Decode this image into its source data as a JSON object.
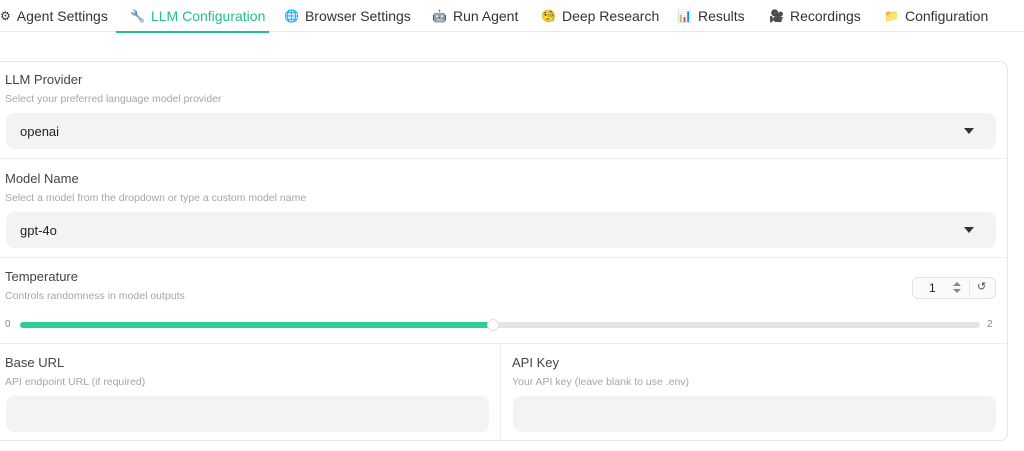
{
  "tabs": [
    {
      "icon": "⚙",
      "label": "Agent Settings"
    },
    {
      "icon": "🔧",
      "label": "LLM Configuration"
    },
    {
      "icon": "🌐",
      "label": "Browser Settings"
    },
    {
      "icon": "🤖",
      "label": "Run Agent"
    },
    {
      "icon": "🧐",
      "label": "Deep Research"
    },
    {
      "icon": "📊",
      "label": "Results"
    },
    {
      "icon": "🎥",
      "label": "Recordings"
    },
    {
      "icon": "📁",
      "label": "Configuration"
    }
  ],
  "active_tab": "LLM Configuration",
  "provider": {
    "label": "LLM Provider",
    "hint": "Select your preferred language model provider",
    "value": "openai"
  },
  "model": {
    "label": "Model Name",
    "hint": "Select a model from the dropdown or type a custom model name",
    "value": "gpt-4o"
  },
  "temperature": {
    "label": "Temperature",
    "hint": "Controls randomness in model outputs",
    "value": "1",
    "min": "0",
    "max": "2",
    "reset_icon": "↺"
  },
  "base_url": {
    "label": "Base URL",
    "hint": "API endpoint URL (if required)",
    "value": ""
  },
  "api_key": {
    "label": "API Key",
    "hint": "Your API key (leave blank to use .env)",
    "value": ""
  },
  "colors": {
    "accent": "#22c08a",
    "slider_fill": "#2fcf94"
  }
}
